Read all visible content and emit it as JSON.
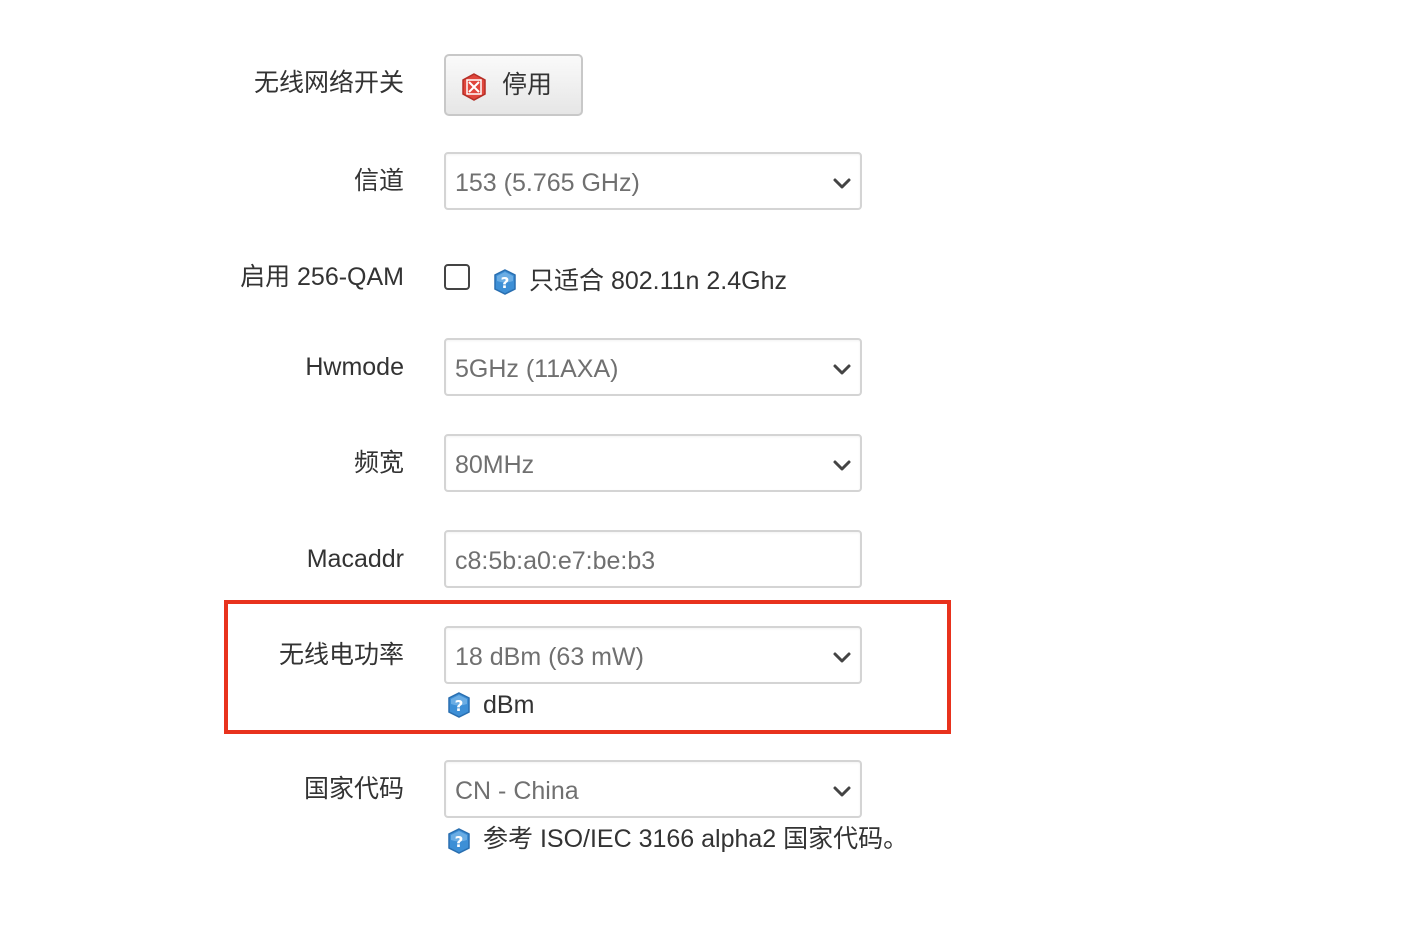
{
  "rows": {
    "wifi_switch": {
      "label": "无线网络开关",
      "button_label": "停用"
    },
    "channel": {
      "label": "信道",
      "value": "153 (5.765 GHz)"
    },
    "qam": {
      "label": "启用 256-QAM",
      "checked": false,
      "hint": "只适合 802.11n 2.4Ghz"
    },
    "hwmode": {
      "label": "Hwmode",
      "value": "5GHz (11AXA)"
    },
    "bandwidth": {
      "label": "频宽",
      "value": "80MHz"
    },
    "macaddr": {
      "label": "Macaddr",
      "value": "c8:5b:a0:e7:be:b3"
    },
    "tx_power": {
      "label": "无线电功率",
      "value": "18 dBm (63 mW)",
      "hint": "dBm"
    },
    "country": {
      "label": "国家代码",
      "value": "CN - China",
      "hint": "参考 ISO/IEC 3166 alpha2 国家代码。"
    }
  },
  "icons": {
    "disable": "close-x-icon",
    "help": "question-icon",
    "dropdown": "chevron-down-icon"
  },
  "colors": {
    "highlight_border": "#e8321d",
    "disable_icon": "#e0463c",
    "help_icon": "#3d8fd6"
  }
}
